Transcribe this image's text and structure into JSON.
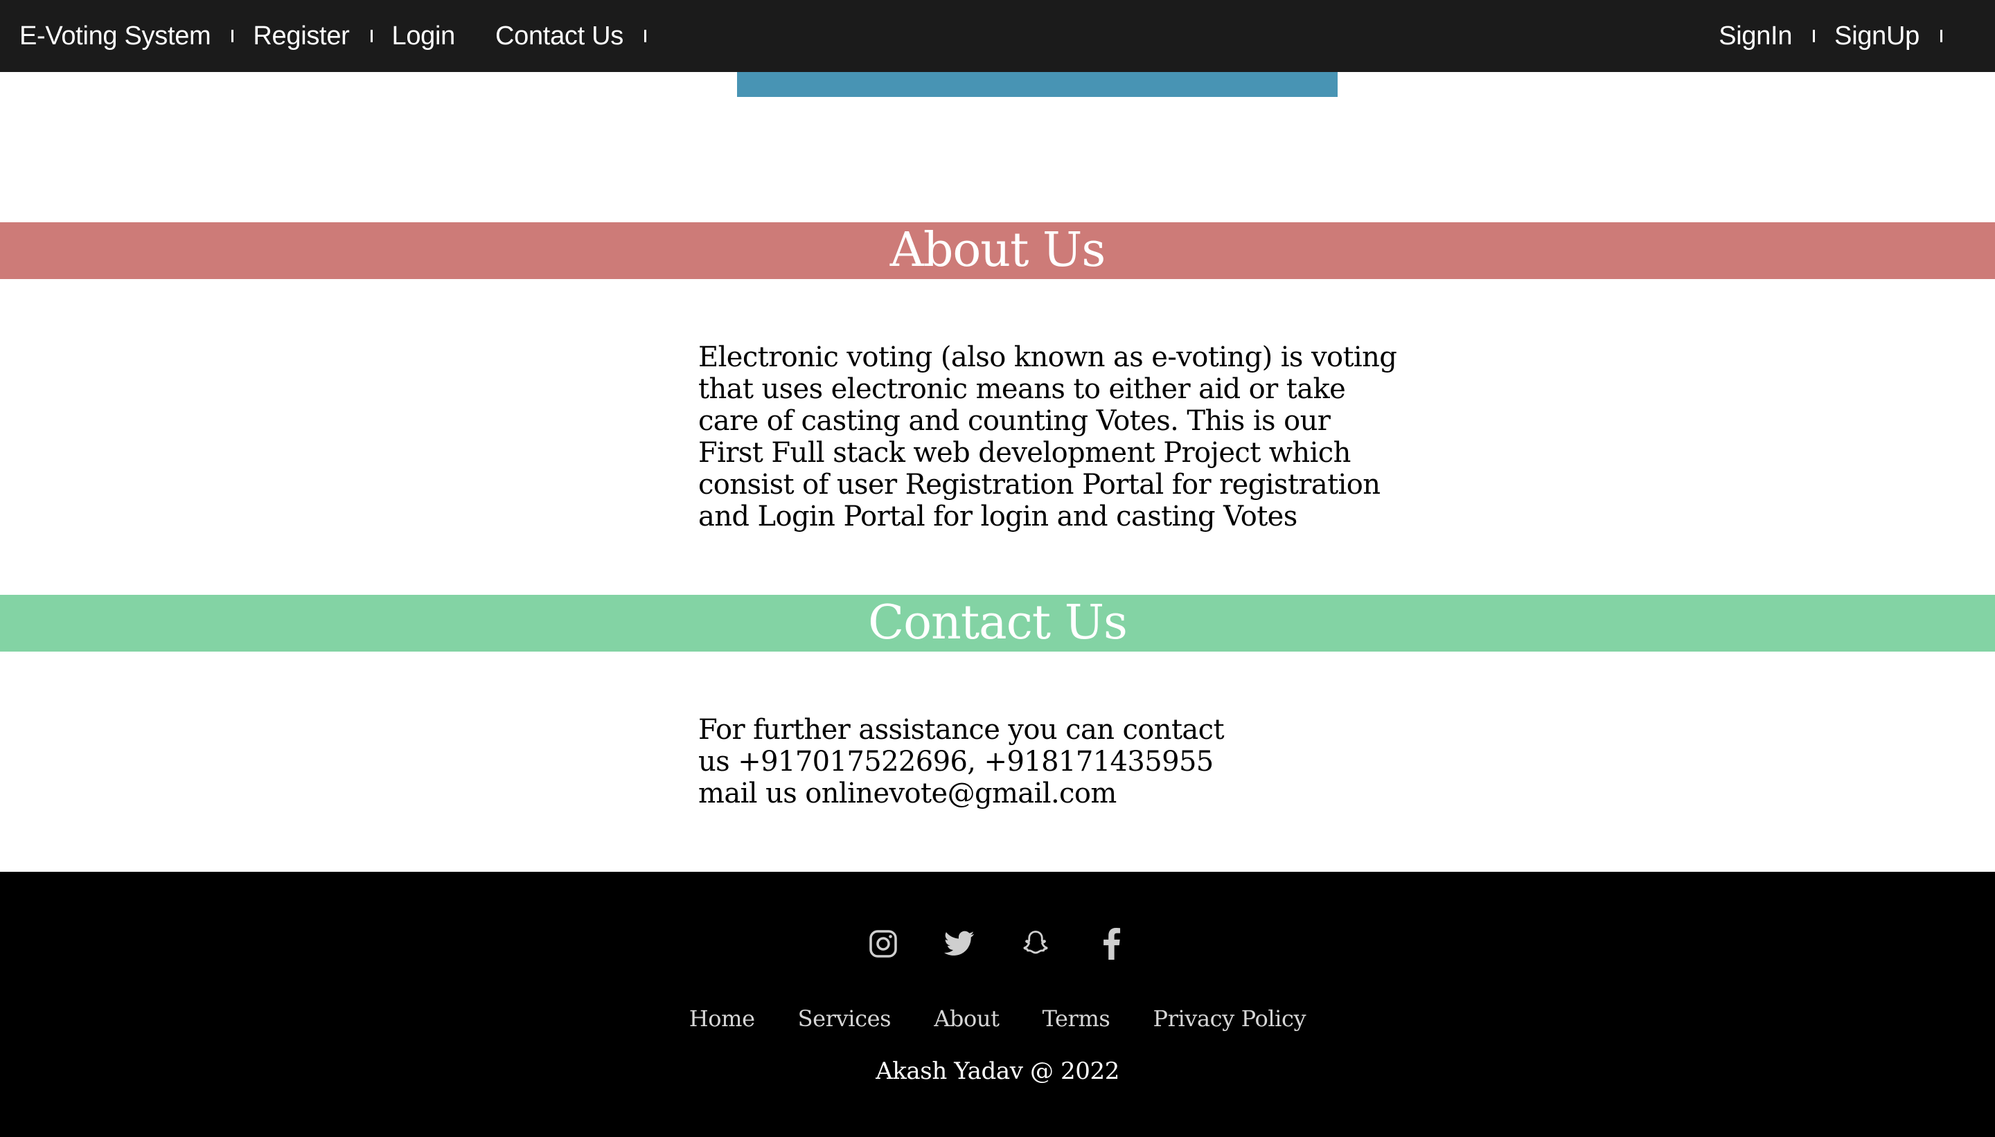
{
  "nav": {
    "brand": "E-Voting System",
    "register": "Register",
    "login": "Login",
    "contact": "Contact Us",
    "signin": "SignIn",
    "signup": "SignUp"
  },
  "about": {
    "heading": "About Us",
    "text": "Electronic voting (also known as e-voting) is voting that uses electronic means to either aid or take care of casting and counting Votes. This is our First Full stack web development Project which consist of user Registration Portal for registration and Login Portal for login and casting Votes"
  },
  "contact": {
    "heading": "Contact Us",
    "text": "For further assistance you can contact us +917017522696, +918171435955 mail us onlinevote@gmail.com"
  },
  "footer": {
    "social_icons": [
      "instagram-icon",
      "twitter-icon",
      "snapchat-icon",
      "facebook-icon"
    ],
    "links": [
      "Home",
      "Services",
      "About",
      "Terms",
      "Privacy Policy"
    ],
    "copyright": "Akash Yadav @ 2022"
  },
  "colors": {
    "nav_bg": "#1b1b1b",
    "hero_bar": "#4894b4",
    "about_band": "#cd7b78",
    "contact_band": "#83d3a4",
    "footer_bg": "#000000"
  }
}
